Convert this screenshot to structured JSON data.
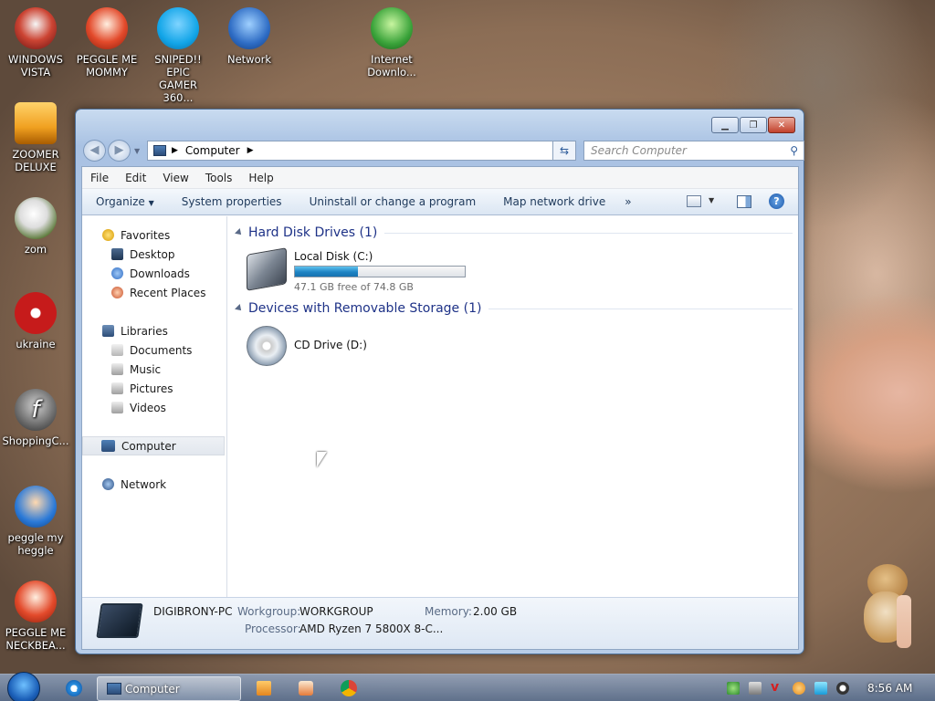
{
  "desktop_icons": [
    {
      "label": "WINDOWS\nVISTA",
      "icon": "vista-icon",
      "color": "#d22b2b"
    },
    {
      "label": "PEGGLE ME\nMOMMY",
      "icon": "peggle-icon",
      "color": "#e34a2b"
    },
    {
      "label": "SNIPED!! EPIC\nGAMER 360...",
      "icon": "skype-icon",
      "color": "#12a5e8"
    },
    {
      "label": "Network",
      "icon": "network-globe-icon",
      "color": "#2e6cc4"
    },
    {
      "label": "Internet\nDownlo...",
      "icon": "internet-download-icon",
      "color": "#3aa33a"
    },
    {
      "label": "ZOOMER\nDELUXE",
      "icon": "zoomer-icon",
      "color": "#f0a020"
    },
    {
      "label": "zom",
      "icon": "zom-icon",
      "color": "#e7e7e7"
    },
    {
      "label": "ukraine",
      "icon": "radiation-icon",
      "color": "#c61b1b"
    },
    {
      "label": "ShoppingC...",
      "icon": "flash-icon",
      "color": "#4a4a4a"
    },
    {
      "label": "peggle my\nheggle",
      "icon": "peggle-icon",
      "color": "#2a79d8"
    },
    {
      "label": "PEGGLE ME\nNECKBEA...",
      "icon": "peggle-icon",
      "color": "#e34a2b"
    }
  ],
  "window": {
    "address": "Computer",
    "search_placeholder": "Search Computer",
    "menu": [
      "File",
      "Edit",
      "View",
      "Tools",
      "Help"
    ],
    "commands": [
      "Organize",
      "System properties",
      "Uninstall or change a program",
      "Map network drive",
      "»"
    ],
    "nav": {
      "favorites": "Favorites",
      "favorites_items": [
        "Desktop",
        "Downloads",
        "Recent Places"
      ],
      "libraries": "Libraries",
      "libraries_items": [
        "Documents",
        "Music",
        "Pictures",
        "Videos"
      ],
      "computer": "Computer",
      "network": "Network"
    },
    "groups": {
      "hdd_header": "Hard Disk Drives (1)",
      "removable_header": "Devices with Removable Storage (1)"
    },
    "drive_c": {
      "name": "Local Disk (C:)",
      "free": "47.1 GB free of 74.8 GB",
      "used_fraction": 0.37
    },
    "drive_d": {
      "name": "CD Drive (D:)"
    },
    "details": {
      "pc_name": "DIGIBRONY-PC",
      "workgroup_label": "Workgroup:",
      "workgroup": "WORKGROUP",
      "memory_label": "Memory:",
      "memory": "2.00 GB",
      "processor_label": "Processor:",
      "processor": "AMD Ryzen 7 5800X 8-C..."
    }
  },
  "taskbar": {
    "active_window": "Computer",
    "clock": "8:56 AM"
  }
}
